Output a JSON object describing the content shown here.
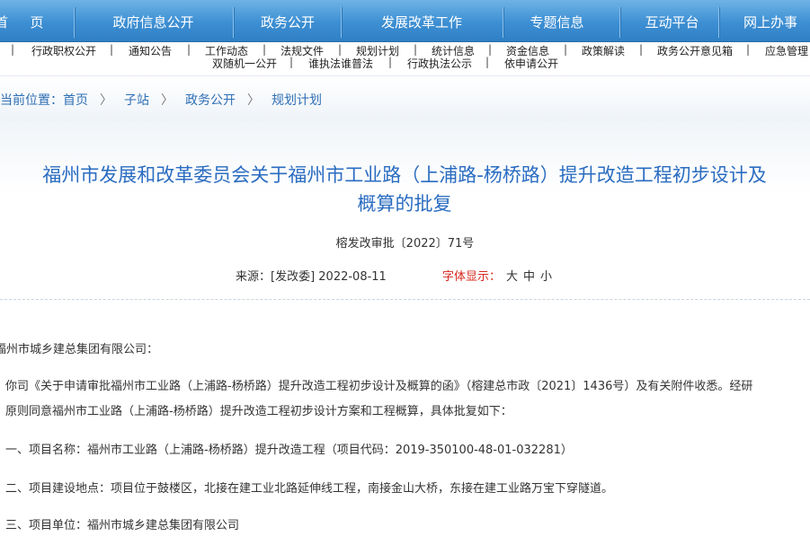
{
  "top_nav": [
    "页",
    "政府信息公开",
    "政务公开",
    "发展改革工作",
    "专题信息",
    "互动平台",
    "网上办事"
  ],
  "top_nav_first": "首",
  "sub_nav": {
    "row1": [
      "行政职权公开",
      "通知公告",
      "工作动态",
      "法规文件",
      "规划计划",
      "统计信息",
      "资金信息",
      "政策解读",
      "政务公开意见箱",
      "应急管理"
    ],
    "row2": [
      "双随机一公开",
      "谁执法谁普法",
      "行政执法公示",
      "依申请公开"
    ]
  },
  "breadcrumb": {
    "label": "当前位置：",
    "items": [
      "首页",
      "子站",
      "政务公开",
      "规划计划"
    ],
    "separator": "〉"
  },
  "article": {
    "title_line1": "福州市发展和改革委员会关于福州市工业路（上浦路-杨桥路）提升改造工程初步设计及",
    "title_line2": "概算的批复",
    "doc_number": "榕发改审批〔2022〕71号",
    "source": "来源：[发改委] 2022-08-11",
    "font_label": "字体显示：",
    "font_options": [
      "大",
      "中",
      "小"
    ],
    "addressee": "福州市城乡建总集团有限公司：",
    "para1_line1": "你司《关于申请审批福州市工业路（上浦路-杨桥路）提升改造工程初步设计及概算的函》（榕建总市政〔2021〕1436号）及有关附件收悉。经研",
    "para1_line2": "原则同意福州市工业路（上浦路-杨桥路）提升改造工程初步设计方案和工程概算，具体批复如下：",
    "item1": "一、项目名称：福州市工业路（上浦路-杨桥路）提升改造工程（项目代码：2019-350100-48-01-032281）",
    "item2": "二、项目建设地点：项目位于鼓楼区，北接在建工业北路延伸线工程，南接金山大桥，东接在建工业路万宝下穿隧道。",
    "item3": "三、项目单位：福州市城乡建总集团有限公司"
  },
  "colors": {
    "nav_blue": "#3d8fd3",
    "title_blue": "#2a6cc1",
    "link_blue": "#2f6fb5",
    "font_label_red": "#d8281f"
  }
}
